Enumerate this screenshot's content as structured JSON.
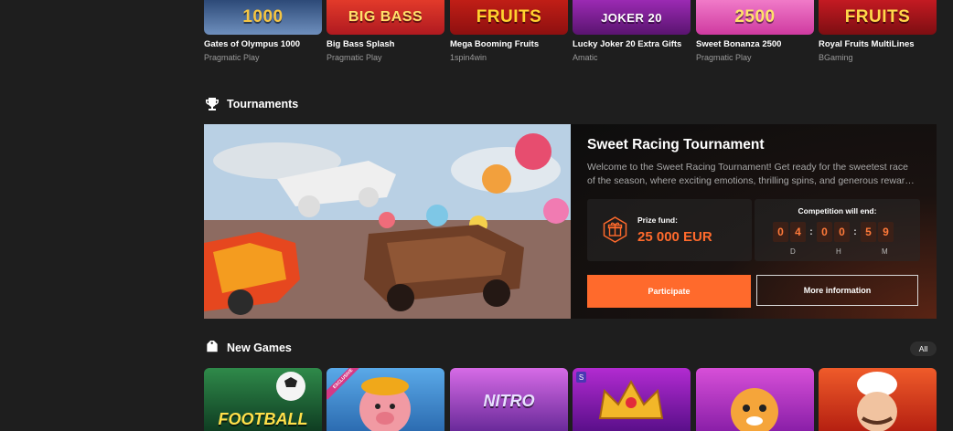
{
  "top_games": [
    {
      "title": "Gates of Olympus 1000",
      "provider": "Pragmatic Play",
      "thumb_text": "1000",
      "bg": "#3f5d8a",
      "fg": "#f5c542"
    },
    {
      "title": "Big Bass Splash",
      "provider": "Pragmatic Play",
      "thumb_text": "BIG BASS",
      "bg": "#c8242b",
      "fg": "#ffe16b"
    },
    {
      "title": "Mega Booming Fruits",
      "provider": "1spin4win",
      "thumb_text": "FRUITS",
      "bg": "#b11717",
      "fg": "#ffd22f"
    },
    {
      "title": "Lucky Joker 20 Extra Gifts",
      "provider": "Amatic",
      "thumb_text": "JOKER 20",
      "bg": "#7a1f8f",
      "fg": "#ffffff"
    },
    {
      "title": "Sweet Bonanza 2500",
      "provider": "Pragmatic Play",
      "thumb_text": "2500",
      "bg": "#e54fb4",
      "fg": "#ffe26a"
    },
    {
      "title": "Royal Fruits MultiLines",
      "provider": "BGaming",
      "thumb_text": "FRUITS",
      "bg": "#a3121a",
      "fg": "#ffd84a"
    }
  ],
  "tournaments_section": {
    "title": "Tournaments",
    "icon": "trophy-icon"
  },
  "tournament": {
    "title": "Sweet Racing Tournament",
    "description_line1": "Welcome to the Sweet Racing Tournament! Get ready for the sweetest race",
    "description_line2": "of the season, where exciting emotions, thrilling spins, and generous rewar…",
    "prize_label": "Prize fund:",
    "prize_value": "25 000 EUR",
    "timer_label": "Competition will end:",
    "days": [
      "0",
      "4"
    ],
    "hours": [
      "0",
      "0"
    ],
    "minutes": [
      "5",
      "9"
    ],
    "unit_days": "D",
    "unit_hours": "H",
    "unit_minutes": "M",
    "participate_label": "Participate",
    "more_label": "More information",
    "accent_color": "#ff6a2c"
  },
  "new_games_section": {
    "title": "New Games",
    "icon": "tag-icon",
    "all_label": "All"
  },
  "new_games": [
    {
      "thumb_text": "FOOTBALL",
      "bg": "#1f6b3a",
      "fg": "#ffe04a"
    },
    {
      "thumb_text": "",
      "bg": "#3d8bd6",
      "fg": "#ffffff",
      "badge": "EXCLUSIVE"
    },
    {
      "thumb_text": "NITRO",
      "bg": "#c54fd9",
      "fg": "#e8e2ff"
    },
    {
      "thumb_text": "",
      "bg": "#8b1fae",
      "fg": "#ffd84a",
      "badge": "S"
    },
    {
      "thumb_text": "",
      "bg": "#c43bc9",
      "fg": "#ffffff"
    },
    {
      "thumb_text": "",
      "bg": "#e0462a",
      "fg": "#ffffff"
    }
  ]
}
